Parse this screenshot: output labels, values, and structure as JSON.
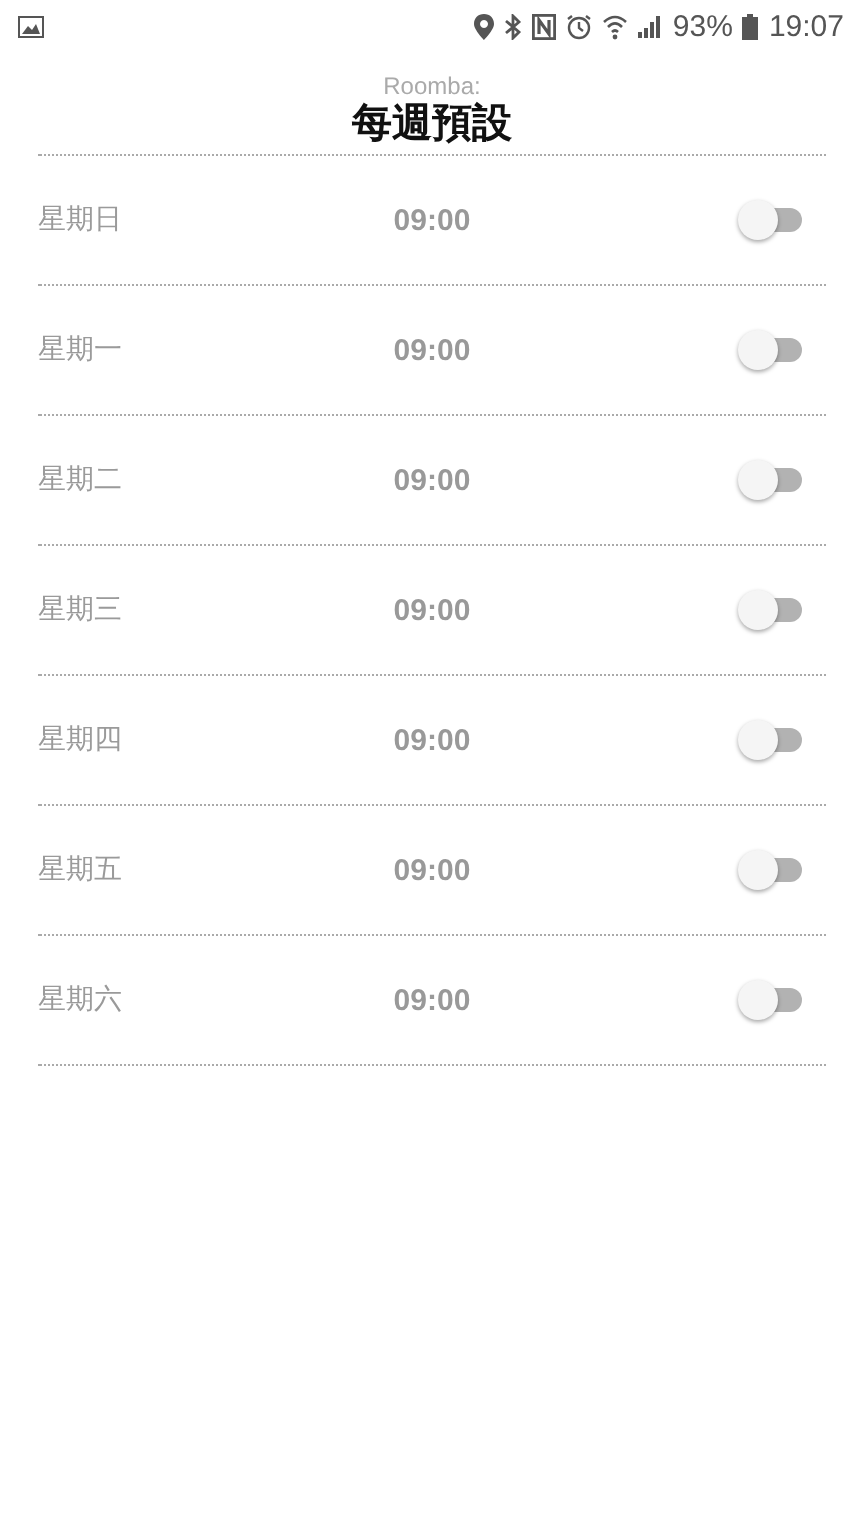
{
  "status_bar": {
    "battery": "93%",
    "time": "19:07"
  },
  "header": {
    "subtitle": "Roomba:",
    "title": "每週預設"
  },
  "schedule": [
    {
      "day": "星期日",
      "time": "09:00",
      "on": false
    },
    {
      "day": "星期一",
      "time": "09:00",
      "on": false
    },
    {
      "day": "星期二",
      "time": "09:00",
      "on": false
    },
    {
      "day": "星期三",
      "time": "09:00",
      "on": false
    },
    {
      "day": "星期四",
      "time": "09:00",
      "on": false
    },
    {
      "day": "星期五",
      "time": "09:00",
      "on": false
    },
    {
      "day": "星期六",
      "time": "09:00",
      "on": false
    }
  ]
}
